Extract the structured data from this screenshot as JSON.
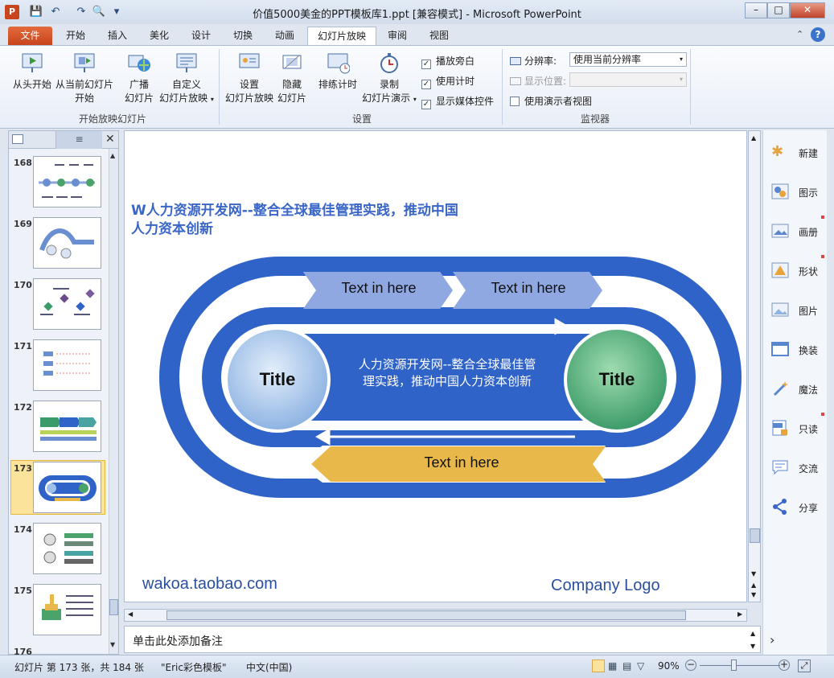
{
  "window": {
    "title": "价值5000美金的PPT模板库1.ppt [兼容模式] - Microsoft PowerPoint",
    "app_icon": "P"
  },
  "tabs": [
    "文件",
    "开始",
    "插入",
    "美化",
    "设计",
    "切换",
    "动画",
    "幻灯片放映",
    "审阅",
    "视图"
  ],
  "ribbon": {
    "from_start": "从头开始",
    "from_current_1": "从当前幻灯片",
    "from_current_2": "开始",
    "broadcast_1": "广播",
    "broadcast_2": "幻灯片",
    "custom_1": "自定义",
    "custom_2": "幻灯片放映",
    "group_start": "开始放映幻灯片",
    "setup_1": "设置",
    "setup_2": "幻灯片放映",
    "hide_1": "隐藏",
    "hide_2": "幻灯片",
    "rehearse": "排练计时",
    "record_1": "录制",
    "record_2": "幻灯片演示",
    "play_narration": "播放旁白",
    "use_timings": "使用计时",
    "show_media": "显示媒体控件",
    "group_setup": "设置",
    "resolution_label": "分辨率:",
    "resolution_value": "使用当前分辨率",
    "display_pos_label": "显示位置:",
    "presenter_view": "使用演示者视图",
    "group_monitor": "监视器"
  },
  "thumbnails": [
    "168",
    "169",
    "170",
    "171",
    "172",
    "173",
    "174",
    "175",
    "176"
  ],
  "slide": {
    "heading_1": "W人力资源开发网--整合全球最佳管理实践，推动中国",
    "heading_2": "人力资本创新",
    "arrow1": "Text in here",
    "arrow2": "Text in here",
    "arrow3": "Text in here",
    "title_left": "Title",
    "title_right": "Title",
    "center_1": "人力资源开发网--整合全球最佳管",
    "center_2": "理实践，推动中国人力资本创新",
    "website": "wakoa.taobao.com",
    "logo": "Company Logo"
  },
  "notes_placeholder": "单击此处添加备注",
  "sidepanel": [
    "新建",
    "图示",
    "画册",
    "形状",
    "图片",
    "换装",
    "魔法",
    "只读",
    "交流",
    "分享"
  ],
  "status": {
    "slide": "幻灯片 第 173 张，共 184 张",
    "theme": "\"Eric彩色模板\"",
    "lang": "中文(中国)",
    "zoom": "90%"
  },
  "colors": {
    "blue": "#2f63c7",
    "light_arrow": "#8fa8e2",
    "gold": "#e8b84a",
    "heading": "#3a66c8"
  }
}
